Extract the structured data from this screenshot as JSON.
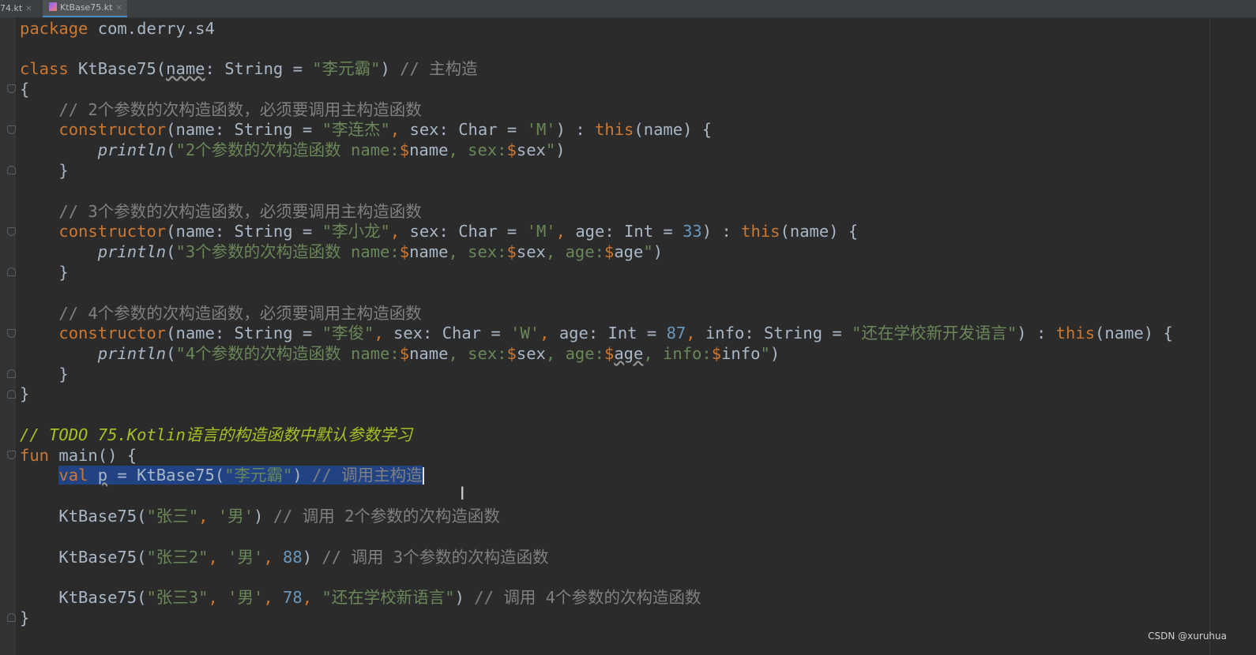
{
  "tabs": [
    {
      "label": "74.kt",
      "active": false
    },
    {
      "label": "KtBase75.kt",
      "active": true
    }
  ],
  "code": {
    "package_kw": "package",
    "package_name": " com.derry.s4",
    "class_kw": "class",
    "class_sig": " KtBase75(",
    "name_param": "name",
    "class_sig_2": ": String = ",
    "class_default": "\"李元霸\"",
    "class_sig_3": ") ",
    "class_comment": "// 主构造",
    "open_brace": "{",
    "close_brace": "}",
    "c2_comment": "// 2个参数的次构造函数，必须要调用主构造函数",
    "c3_comment": "// 3个参数的次构造函数，必须要调用主构造函数",
    "c4_comment": "// 4个参数的次构造函数，必须要调用主构造函数",
    "constructor_kw": "constructor",
    "this_kw": "this",
    "c2_name_default": "\"李连杰\"",
    "c3_name_default": "\"李小龙\"",
    "c4_name_default": "\"李俊\"",
    "sex_m": "'M'",
    "sex_w": "'W'",
    "age_33": "33",
    "age_87": "87",
    "info_default": "\"还在学校新开发语言\"",
    "println": "println",
    "p2_text": "\"2个参数的次构造函数 name:",
    "p3_text": "\"3个参数的次构造函数 name:",
    "p4_text": "\"4个参数的次构造函数 name:",
    "todo_comment": "// TODO 75.Kotlin语言的构造函数中默认参数学习",
    "fun_kw": "fun",
    "main_sig": " main() {",
    "val_kw": "val",
    "val_p": "p",
    "main_l1_call": " = KtBase75(",
    "main_l1_str": "\"李元霸\"",
    "main_l1_comment": "// 调用主构造",
    "call2_str1": "\"张三\"",
    "call2_str2": "'男'",
    "call2_comment": "// 调用 2个参数的次构造函数",
    "call3_str1": "\"张三2\"",
    "call3_num": "88",
    "call3_comment": "// 调用 3个参数的次构造函数",
    "call4_str1": "\"张三3\"",
    "call4_num": "78",
    "call4_str3": "\"还在学校新语言\"",
    "call4_comment": "// 调用 4个参数的次构造函数"
  },
  "watermark": "CSDN @xuruhua"
}
